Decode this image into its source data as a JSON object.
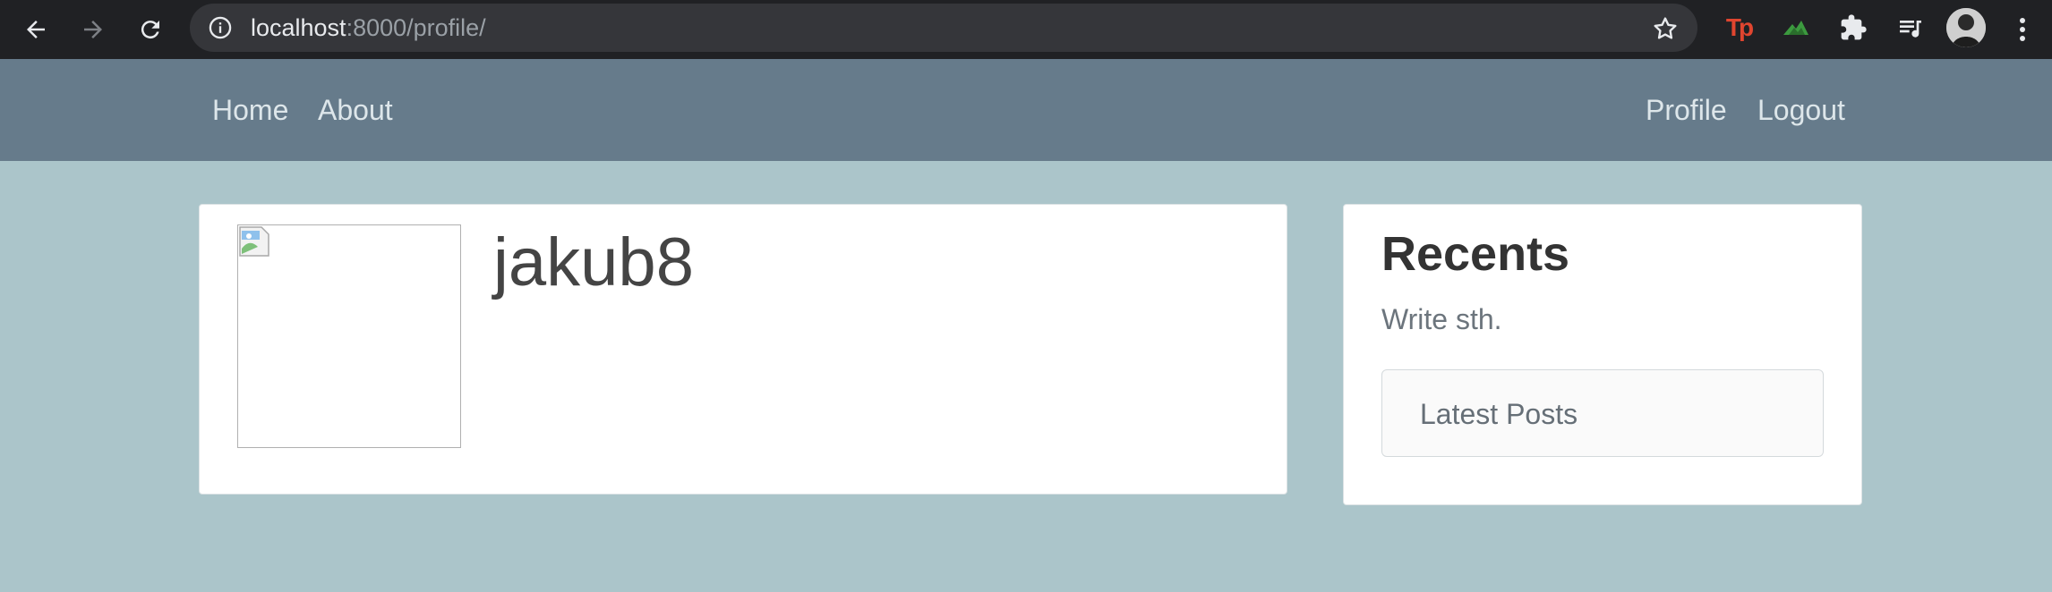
{
  "browser": {
    "url_host": "localhost",
    "url_rest": ":8000/profile/",
    "extensions": [
      "tp-extension-icon",
      "green-extension-icon",
      "puzzle-icon",
      "media-queue-icon"
    ]
  },
  "navbar": {
    "left_links": [
      "Home",
      "About"
    ],
    "right_links": [
      "Profile",
      "Logout"
    ]
  },
  "profile": {
    "username": "jakub8"
  },
  "sidebar": {
    "title": "Recents",
    "subtitle": "Write sth.",
    "latest_posts_label": "Latest Posts"
  },
  "colors": {
    "page_bg": "#abc5ca",
    "navbar_bg": "#667b8b",
    "chrome_bg": "#202124"
  }
}
